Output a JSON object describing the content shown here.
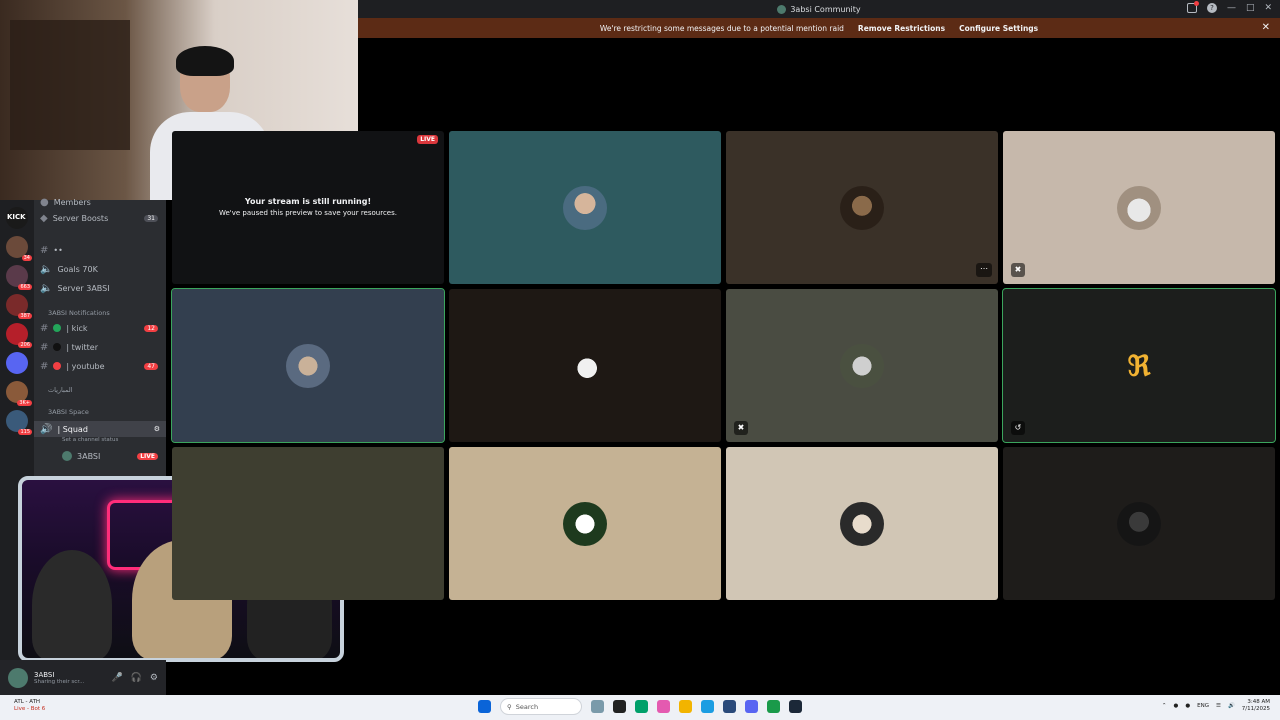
{
  "window": {
    "title": "3absi Community"
  },
  "banner": {
    "message": "We're restricting some messages due to a potential mention raid",
    "remove": "Remove Restrictions",
    "configure": "Configure Settings"
  },
  "sidebar": {
    "top_partial": "Members",
    "items": [
      {
        "label": "Server Boosts",
        "count": "31"
      },
      {
        "label": "••"
      },
      {
        "label": "Goals 70K"
      },
      {
        "label": "Server 3ABSI"
      }
    ],
    "category_notifications": "3ABSI Notifications",
    "notif_channels": [
      {
        "label": "| kick",
        "count": "12",
        "color": "#23a55a"
      },
      {
        "label": "| twitter",
        "color": "#111111"
      },
      {
        "label": "| youtube",
        "count": "47",
        "color": "#f23f43"
      }
    ],
    "category_arabic": "المباريات",
    "category_space": "3ABSI Space",
    "voice_channel": {
      "label": "| Squad",
      "sub": "Set a channel status"
    },
    "voice_member": {
      "name": "3ABSI",
      "live": "LIVE"
    }
  },
  "rail_badges": [
    "34",
    "663",
    "387",
    "206",
    "3K+",
    "115"
  ],
  "user_panel": {
    "name": "3ABSI",
    "status": "Sharing their scr..."
  },
  "call": {
    "live_label": "LIVE",
    "paused_line1": "Your stream is still running!",
    "paused_line2": "We've paused this preview to save your resources."
  },
  "taskbar": {
    "weather_top": "ATL - ATH",
    "weather_sub": "Live - Bot 6",
    "search_placeholder": "Search",
    "lang": "ENG",
    "time": "3:48 AM",
    "date": "7/11/2025"
  },
  "colors": {
    "accent_live": "#da373c",
    "speaking": "#3ba55d",
    "banner": "#5c2b15"
  }
}
